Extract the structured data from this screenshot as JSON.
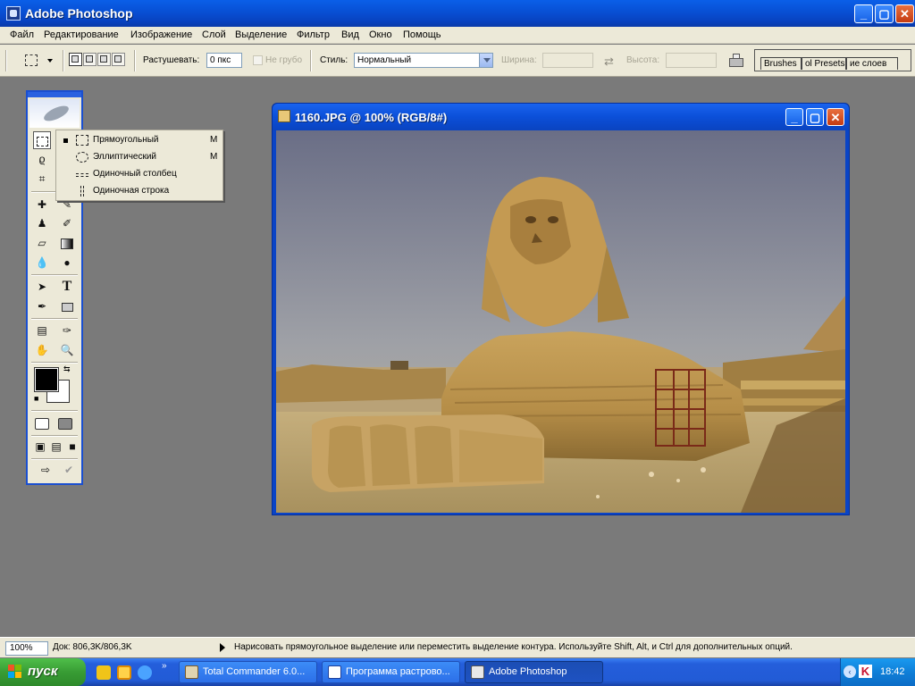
{
  "app": {
    "title": "Adobe Photoshop"
  },
  "menu": [
    "Файл",
    "Редактирование",
    "Изображение",
    "Слой",
    "Выделение",
    "Фильтр",
    "Вид",
    "Окно",
    "Помощь"
  ],
  "options": {
    "feather_label": "Растушевать:",
    "feather_value": "0 пкс",
    "antialias_label": "Не грубо",
    "style_label": "Стиль:",
    "style_value": "Нормальный",
    "width_label": "Ширина:",
    "height_label": "Высота:"
  },
  "palette_well": {
    "tabs": [
      "Brushes",
      "ol Presets",
      "ие слоев"
    ]
  },
  "toolbox": {
    "tools": [
      "marquee-icon",
      "wand-icon",
      "lasso-icon",
      "crop-icon",
      "slice-icon",
      "healing-icon",
      "brush-icon",
      "stamp-icon",
      "history-brush-icon",
      "eraser-icon",
      "gradient-icon",
      "blur-icon",
      "dodge-icon",
      "path-select-icon",
      "type-icon",
      "pen-icon",
      "shape-icon",
      "notes-icon",
      "eyedropper-icon",
      "hand-icon",
      "zoom-icon"
    ],
    "colors": {
      "foreground": "#000000",
      "background": "#ffffff"
    }
  },
  "flyout": {
    "items": [
      {
        "label": "Прямоугольный",
        "shortcut": "M",
        "selected": true,
        "icon": "rect-marquee-icon"
      },
      {
        "label": "Эллиптический",
        "shortcut": "M",
        "selected": false,
        "icon": "ellipse-marquee-icon"
      },
      {
        "label": "Одиночный столбец",
        "shortcut": "",
        "selected": false,
        "icon": "single-row-marquee-icon"
      },
      {
        "label": "Одиночная строка",
        "shortcut": "",
        "selected": false,
        "icon": "single-column-marquee-icon"
      }
    ]
  },
  "document": {
    "title": "1160.JPG @ 100% (RGB/8#)"
  },
  "status": {
    "zoom": "100%",
    "doc_size": "Док: 806,3K/806,3K",
    "hint": "Нарисовать прямоугольное выделение или переместить выделение контура.  Используйте Shift, Alt, и Ctrl для дополнительных опций."
  },
  "taskbar": {
    "start": "пуск",
    "quicklaunch_more": "»",
    "tasks": [
      {
        "label": "Total Commander 6.0...",
        "active": false
      },
      {
        "label": "Программа растрово...",
        "active": false
      },
      {
        "label": "Adobe Photoshop",
        "active": true
      }
    ],
    "clock": "18:42"
  },
  "colors": {
    "xp_blue": "#0a5fe8",
    "start_green": "#389c34",
    "workspace": "#7a7a7a",
    "panel": "#ece9d8"
  }
}
